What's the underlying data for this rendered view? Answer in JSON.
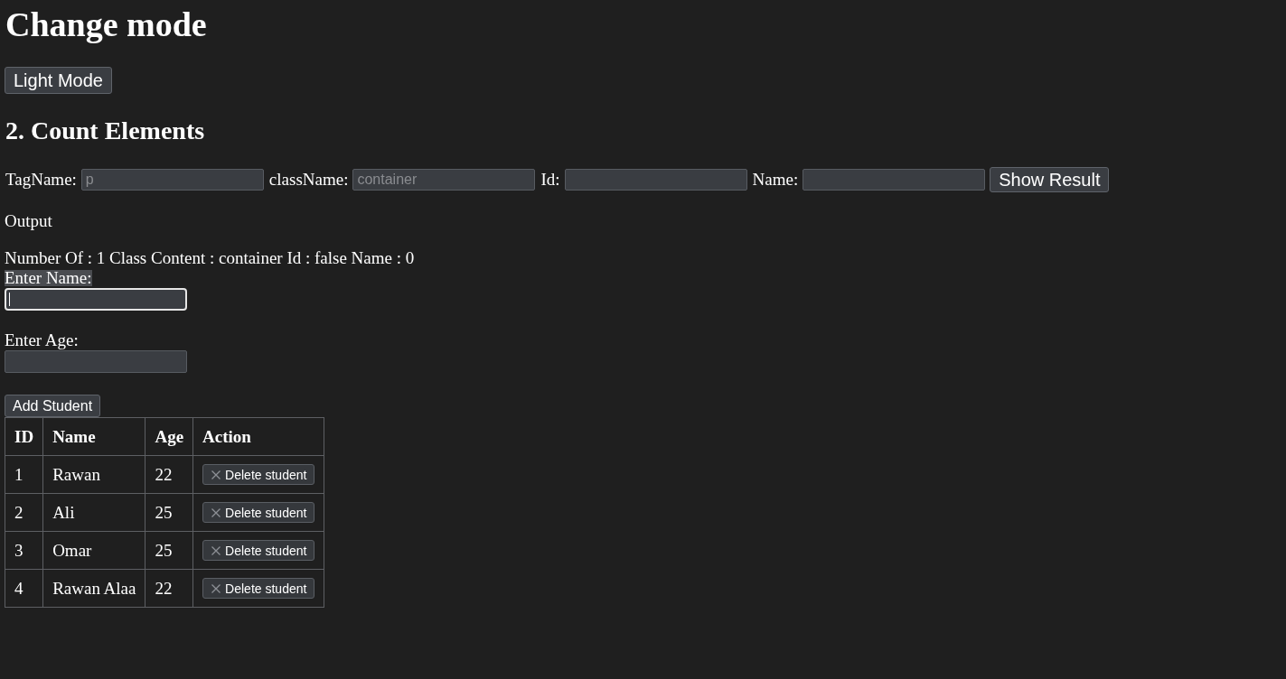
{
  "page_title": "Change mode",
  "mode_button": {
    "label": "Light Mode"
  },
  "count_elements": {
    "title": "2. Count Elements",
    "fields": [
      {
        "label": "TagName:",
        "placeholder": "p"
      },
      {
        "label": "className:",
        "placeholder": "container"
      },
      {
        "label": "Id:"
      },
      {
        "label": "Name:"
      }
    ],
    "button": "Show Result"
  },
  "output": {
    "label": "Output",
    "result": "Number Of : 1 Class Content : container Id : false Name : 0"
  },
  "student_form": {
    "fields": [
      {
        "label": "Enter Name:",
        "highlighted": true,
        "focused": true
      },
      {
        "label": "Enter Age:",
        "highlighted": false,
        "focused": false
      }
    ],
    "button": "Add Student"
  },
  "table": {
    "columns": [
      "ID",
      "Name",
      "Age",
      "Action"
    ],
    "rows": [
      {
        "cells": [
          "1",
          "Rawan",
          "22"
        ],
        "action": "Delete student"
      },
      {
        "cells": [
          "2",
          "Ali",
          "25"
        ],
        "action": "Delete student"
      },
      {
        "cells": [
          "3",
          "Omar",
          "25"
        ],
        "action": "Delete student"
      },
      {
        "cells": [
          "4",
          "Rawan Alaa",
          "22"
        ],
        "action": "Delete student"
      }
    ]
  }
}
